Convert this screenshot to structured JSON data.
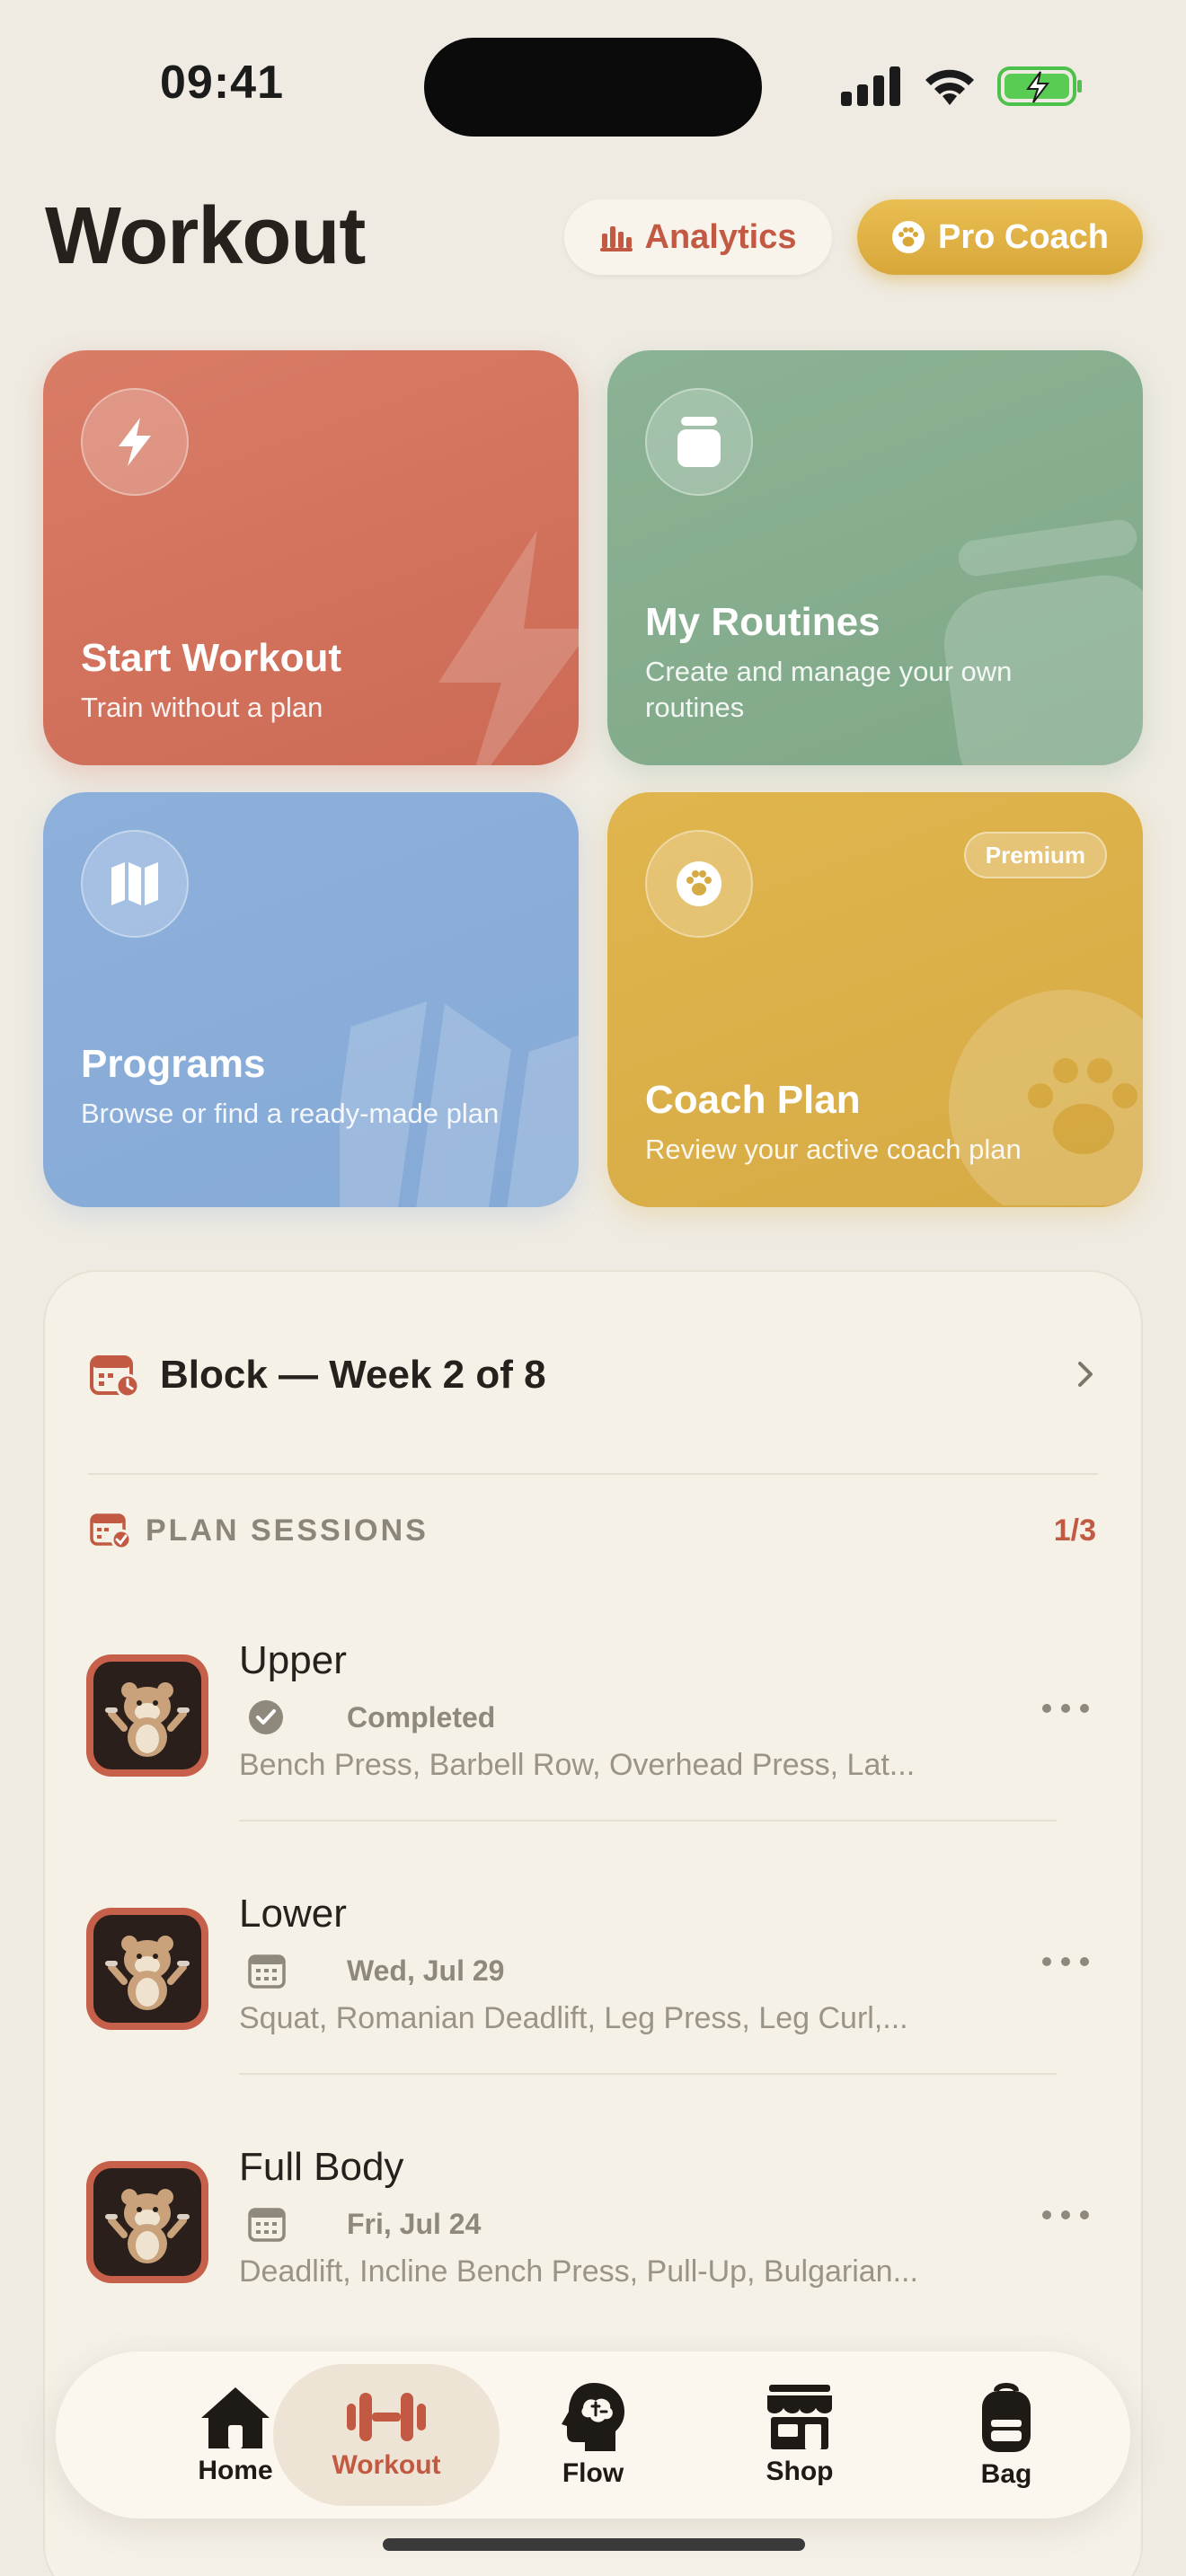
{
  "status_bar": {
    "time": "09:41"
  },
  "header": {
    "title": "Workout",
    "analytics_label": "Analytics",
    "pro_coach_label": "Pro Coach"
  },
  "cards": {
    "start": {
      "title": "Start Workout",
      "subtitle": "Train without a plan",
      "icon": "bolt-icon"
    },
    "routines": {
      "title": "My Routines",
      "subtitle": "Create and manage your own routines",
      "icon": "jar-icon"
    },
    "programs": {
      "title": "Programs",
      "subtitle": "Browse or find a ready-made plan",
      "icon": "map-icon"
    },
    "coach": {
      "title": "Coach Plan",
      "subtitle": "Review your active coach plan",
      "badge": "Premium",
      "icon": "paw-icon"
    }
  },
  "block": {
    "title": "Block — Week 2 of 8",
    "sessions_label": "PLAN SESSIONS",
    "sessions_count": "1/3",
    "sessions": [
      {
        "name": "Upper",
        "status": "Completed",
        "status_icon": "check-circle-icon",
        "exercises": "Bench Press, Barbell Row, Overhead Press, Lat..."
      },
      {
        "name": "Lower",
        "status": "Wed, Jul 29",
        "status_icon": "calendar-icon",
        "exercises": "Squat, Romanian Deadlift, Leg Press, Leg Curl,..."
      },
      {
        "name": "Full Body",
        "status": "Fri, Jul 24",
        "status_icon": "calendar-icon",
        "exercises": "Deadlift, Incline Bench Press, Pull-Up, Bulgarian..."
      }
    ]
  },
  "tabbar": {
    "items": [
      {
        "label": "Home",
        "icon": "home-icon"
      },
      {
        "label": "Workout",
        "icon": "dumbbell-icon",
        "active": true
      },
      {
        "label": "Flow",
        "icon": "brain-head-icon"
      },
      {
        "label": "Shop",
        "icon": "store-icon"
      },
      {
        "label": "Bag",
        "icon": "backpack-icon"
      }
    ]
  },
  "colors": {
    "background": "#EFEBE2",
    "accent_red": "#C25A43",
    "start_card": "#D4735E",
    "routines_card": "#85AD8E",
    "programs_card": "#89ADD8",
    "coach_card": "#DBAF49"
  }
}
